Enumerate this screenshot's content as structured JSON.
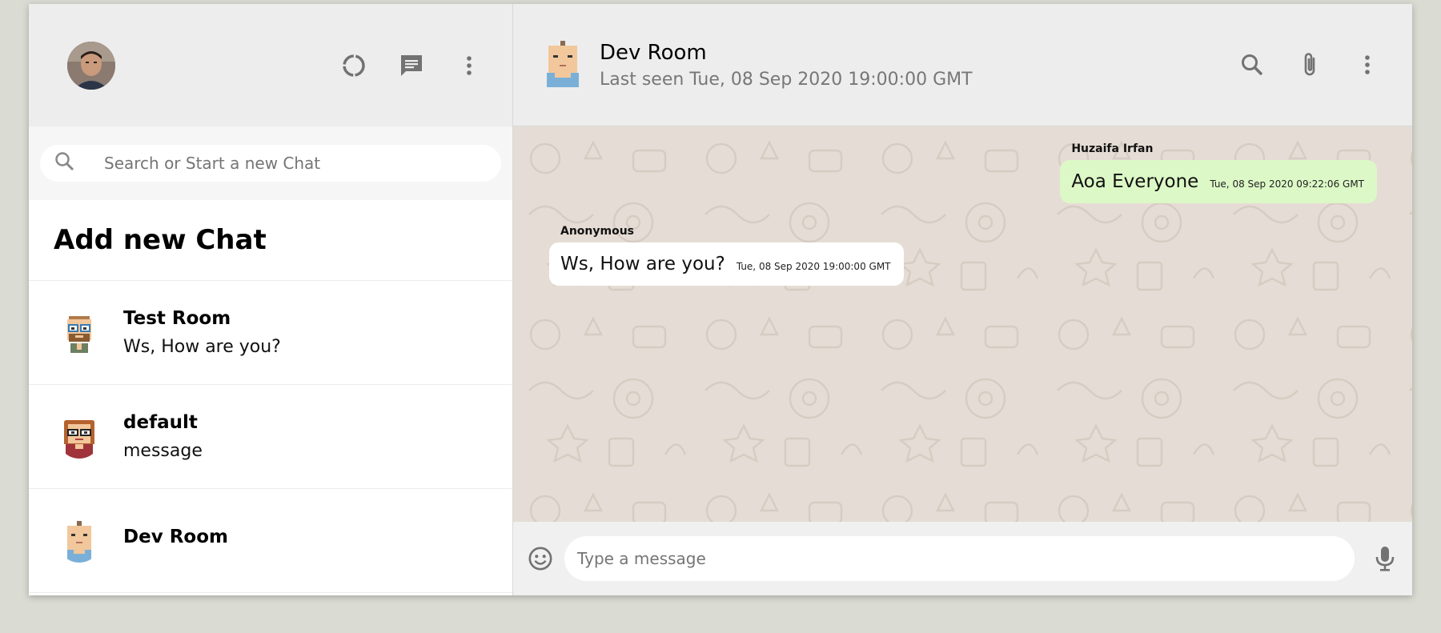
{
  "sidebar": {
    "search_placeholder": "Search or Start a new Chat",
    "add_chat_label": "Add new Chat",
    "chats": [
      {
        "name": "Test Room",
        "last_message": "Ws, How are you?"
      },
      {
        "name": "default",
        "last_message": "message"
      },
      {
        "name": "Dev Room",
        "last_message": ""
      }
    ]
  },
  "header": {
    "room_name": "Dev Room",
    "last_seen": "Last seen Tue, 08 Sep 2020 19:00:00 GMT"
  },
  "messages": [
    {
      "sender": "Huzaifa Irfan",
      "text": "Aoa Everyone",
      "time": "Tue, 08 Sep 2020 09:22:06 GMT",
      "direction": "sent"
    },
    {
      "sender": "Anonymous",
      "text": "Ws, How are you?",
      "time": "Tue, 08 Sep 2020 19:00:00 GMT",
      "direction": "received"
    }
  ],
  "footer": {
    "input_placeholder": "Type a message"
  },
  "icons": {
    "sidebar_header": [
      "status-icon",
      "chat-icon",
      "menu-icon"
    ],
    "main_header": [
      "search-icon",
      "attach-icon",
      "menu-icon"
    ],
    "footer": [
      "emoji-icon",
      "mic-icon"
    ]
  },
  "colors": {
    "sent_bubble": "#dcf8c6",
    "received_bubble": "#ffffff",
    "chat_background": "#e5ddd5",
    "header_background": "#ededed"
  }
}
